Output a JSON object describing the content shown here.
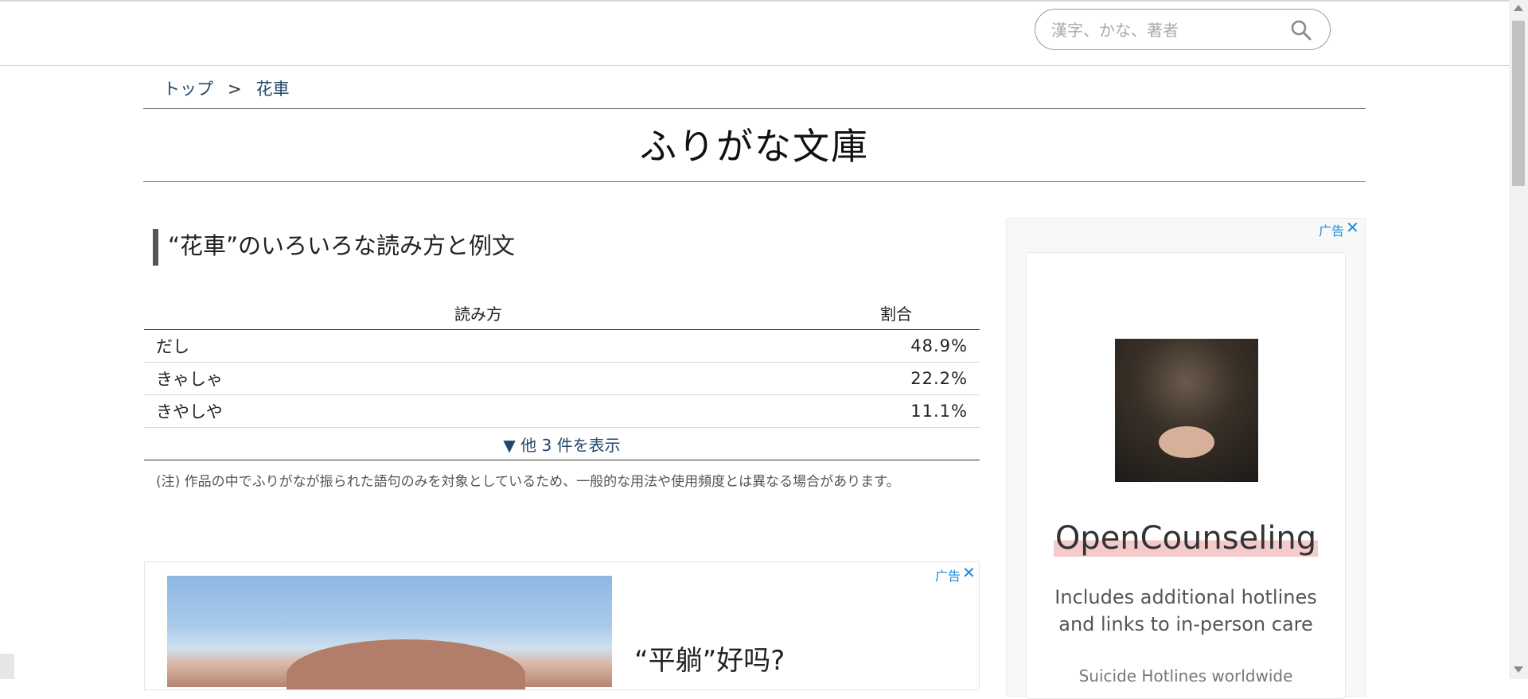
{
  "search": {
    "placeholder": "漢字、かな、著者"
  },
  "breadcrumb": {
    "home": "トップ",
    "separator": ">",
    "current": "花車"
  },
  "site_title": "ふりがな文庫",
  "section": {
    "title": "“花車”のいろいろな読み方と例文"
  },
  "table": {
    "headers": {
      "reading": "読み方",
      "ratio": "割合"
    },
    "rows": [
      {
        "reading": "だし",
        "ratio": "48.9%"
      },
      {
        "reading": "きゃしゃ",
        "ratio": "22.2%"
      },
      {
        "reading": "きやしや",
        "ratio": "11.1%"
      }
    ],
    "show_more": "▼ 他 3 件を表示"
  },
  "note": "(注) 作品の中でふりがなが振られた語句のみを対象としているため、一般的な用法や使用頻度とは異なる場合があります。",
  "ad_bottom": {
    "label": "广告",
    "headline": "“平躺”好吗?"
  },
  "ad_side": {
    "label": "广告",
    "title": "OpenCounseling",
    "description": "Includes additional hotlines and links to in-person care",
    "more": "Suicide Hotlines worldwide"
  },
  "colors": {
    "link": "#23476b",
    "ad_accent": "#1a8cd8",
    "highlight": "#f5caca"
  }
}
